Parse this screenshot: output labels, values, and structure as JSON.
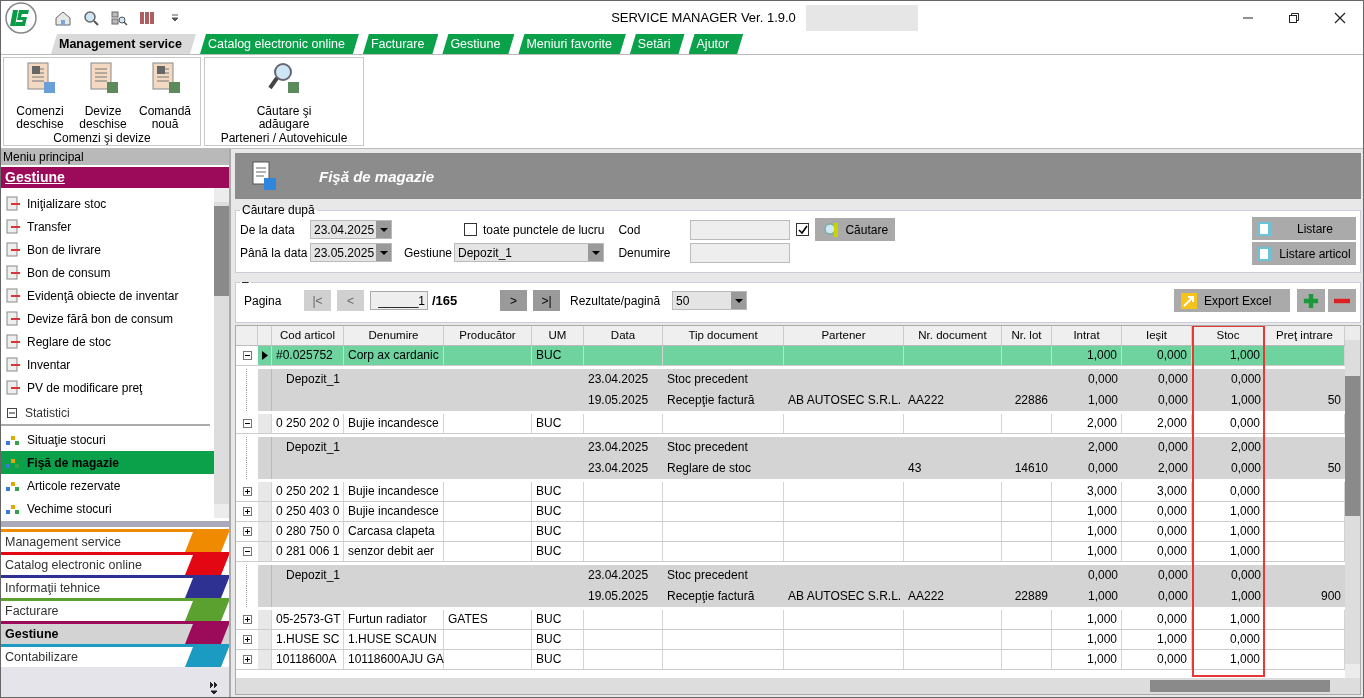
{
  "window": {
    "title": "SERVICE MANAGER Ver. 1.9.0",
    "redacted": true
  },
  "ribbon_tabs": [
    {
      "label": "Management service",
      "selected": true
    },
    {
      "label": "Catalog electronic online",
      "selected": false
    },
    {
      "label": "Facturare",
      "selected": false
    },
    {
      "label": "Gestiune",
      "selected": false
    },
    {
      "label": "Meniuri favorite",
      "selected": false
    },
    {
      "label": "Setări",
      "selected": false
    },
    {
      "label": "Ajutor",
      "selected": false
    }
  ],
  "ribbon_groups": [
    {
      "label": "Comenzi şi devize",
      "buttons": [
        "Comenzi deschise",
        "Devize deschise",
        "Comandă nouă"
      ]
    },
    {
      "label": "Parteneri / Autovehicule",
      "buttons": [
        "Căutare şi adăugare"
      ]
    }
  ],
  "sidebar": {
    "title": "Meniu principal",
    "section": "Gestiune",
    "items": [
      {
        "label": "Iniţializare stoc",
        "selected": false
      },
      {
        "label": "Transfer",
        "selected": false
      },
      {
        "label": "Bon de livrare",
        "selected": false
      },
      {
        "label": "Bon de consum",
        "selected": false
      },
      {
        "label": "Evidenţă obiecte de inventar",
        "selected": false
      },
      {
        "label": "Devize fără bon de consum",
        "selected": false
      },
      {
        "label": "Reglare de stoc",
        "selected": false
      },
      {
        "label": "Inventar",
        "selected": false
      },
      {
        "label": "PV de modificare preţ",
        "selected": false
      }
    ],
    "group": {
      "label": "Statistici",
      "expanded": true,
      "items": [
        {
          "label": "Situaţie stocuri",
          "selected": false
        },
        {
          "label": "Fişă de magazie",
          "selected": true
        },
        {
          "label": "Articole rezervate",
          "selected": false
        },
        {
          "label": "Vechime stocuri",
          "selected": false
        }
      ]
    },
    "nav": [
      {
        "label": "Management service",
        "color": "#f08a00",
        "selected": false
      },
      {
        "label": "Catalog electronic online",
        "color": "#e30613",
        "selected": false
      },
      {
        "label": "Informaţii tehnice",
        "color": "#2e3192",
        "selected": false
      },
      {
        "label": "Facturare",
        "color": "#5ba12f",
        "selected": false
      },
      {
        "label": "Gestiune",
        "color": "#9c0a5a",
        "selected": true
      },
      {
        "label": "Contabilizare",
        "color": "#1b9ac2",
        "selected": false
      }
    ]
  },
  "page": {
    "title": "Fişă de magazie",
    "search": {
      "legend": "Căutare după",
      "from_label": "De la data",
      "from": "23.04.2025",
      "to_label": "Până la data",
      "to": "23.05.2025",
      "all_points_label": "toate punctele de lucru",
      "all_points": false,
      "gestiune_label": "Gestiune",
      "gestiune": "Depozit_1",
      "cod_label": "Cod",
      "cod_checked": true,
      "denumire_label": "Denumire",
      "search_button": "Căutare",
      "buttons": [
        "Listare",
        "Listare articol"
      ]
    },
    "paging": {
      "legend": "–",
      "page_label": "Pagina",
      "first": {
        "label": "|<",
        "disabled": true
      },
      "prev": {
        "label": "<",
        "disabled": true
      },
      "page": "______1",
      "total": "/165",
      "next": {
        "label": ">",
        "disabled": false
      },
      "last": {
        "label": ">|",
        "disabled": false
      },
      "per_page_label": "Rezultate/pagină",
      "per_page": "50",
      "export": "Export Excel"
    },
    "columns": [
      {
        "label": "Cod articol",
        "highlighted": false
      },
      {
        "label": "Denumire",
        "highlighted": false
      },
      {
        "label": "Producător",
        "highlighted": false
      },
      {
        "label": "UM",
        "highlighted": false
      },
      {
        "label": "Data",
        "highlighted": false
      },
      {
        "label": "Tip document",
        "highlighted": false
      },
      {
        "label": "Partener",
        "highlighted": false
      },
      {
        "label": "Nr. document",
        "highlighted": false
      },
      {
        "label": "Nr. lot",
        "highlighted": false
      },
      {
        "label": "Intrat",
        "highlighted": false
      },
      {
        "label": "Ieşit",
        "highlighted": false
      },
      {
        "label": "Stoc",
        "highlighted": true
      },
      {
        "label": "Preţ intrare",
        "highlighted": false
      }
    ],
    "rows": [
      {
        "expanded": true,
        "selected": true,
        "cod": "#0.025752",
        "denumire": "Corp ax cardanic",
        "um": "BUC",
        "intrat": "1,000",
        "iesit": "0,000",
        "stoc": "1,000",
        "details": [
          {
            "gestiune": "Depozit_1",
            "data": "23.04.2025",
            "tip": "Stoc precedent",
            "intrat": "0,000",
            "iesit": "0,000",
            "stoc": "0,000"
          },
          {
            "data": "19.05.2025",
            "tip": "Recepţie factură",
            "partener": "AB AUTOSEC S.R.L.",
            "nr_document": "AA222",
            "nr_lot": "22886",
            "intrat": "1,000",
            "iesit": "0,000",
            "stoc": "1,000",
            "pret": "50"
          }
        ]
      },
      {
        "expanded": true,
        "selected": false,
        "cod": "0 250 202 0",
        "denumire": "Bujie incandesce",
        "um": "BUC",
        "intrat": "2,000",
        "iesit": "2,000",
        "stoc": "0,000",
        "details": [
          {
            "gestiune": "Depozit_1",
            "data": "23.04.2025",
            "tip": "Stoc precedent",
            "intrat": "2,000",
            "iesit": "0,000",
            "stoc": "2,000"
          },
          {
            "data": "23.04.2025",
            "tip": "Reglare de stoc",
            "nr_document": "43",
            "nr_lot": "14610",
            "intrat": "0,000",
            "iesit": "2,000",
            "stoc": "0,000",
            "pret": "50"
          }
        ]
      },
      {
        "expanded": false,
        "selected": false,
        "cod": "0 250 202 1",
        "denumire": "Bujie incandesce",
        "um": "BUC",
        "intrat": "3,000",
        "iesit": "3,000",
        "stoc": "0,000"
      },
      {
        "expanded": false,
        "selected": false,
        "cod": "0 250 403 0",
        "denumire": "Bujie incandesce",
        "um": "BUC",
        "intrat": "1,000",
        "iesit": "0,000",
        "stoc": "1,000"
      },
      {
        "expanded": false,
        "selected": false,
        "cod": "0 280 750 0",
        "denumire": "Carcasa clapeta",
        "um": "BUC",
        "intrat": "1,000",
        "iesit": "0,000",
        "stoc": "1,000"
      },
      {
        "expanded": true,
        "selected": false,
        "cod": "0 281 006 1",
        "denumire": "senzor debit aer",
        "um": "BUC",
        "intrat": "1,000",
        "iesit": "0,000",
        "stoc": "1,000",
        "details": [
          {
            "gestiune": "Depozit_1",
            "data": "23.04.2025",
            "tip": "Stoc precedent",
            "intrat": "0,000",
            "iesit": "0,000",
            "stoc": "0,000"
          },
          {
            "data": "19.05.2025",
            "tip": "Recepţie factură",
            "partener": "AB AUTOSEC S.R.L.",
            "nr_document": "AA222",
            "nr_lot": "22889",
            "intrat": "1,000",
            "iesit": "0,000",
            "stoc": "1,000",
            "pret": "900"
          }
        ]
      },
      {
        "expanded": false,
        "selected": false,
        "cod": "05-2573-GT",
        "denumire": "Furtun radiator",
        "producator": "GATES",
        "um": "BUC",
        "intrat": "1,000",
        "iesit": "0,000",
        "stoc": "1,000"
      },
      {
        "expanded": false,
        "selected": false,
        "cod": "1.HUSE SC",
        "denumire": "1.HUSE SCAUN",
        "um": "BUC",
        "intrat": "1,000",
        "iesit": "1,000",
        "stoc": "0,000"
      },
      {
        "expanded": false,
        "selected": false,
        "cod": "10118600A",
        "denumire": "10118600AJU GA",
        "um": "BUC",
        "intrat": "1,000",
        "iesit": "0,000",
        "stoc": "1,000"
      }
    ]
  }
}
